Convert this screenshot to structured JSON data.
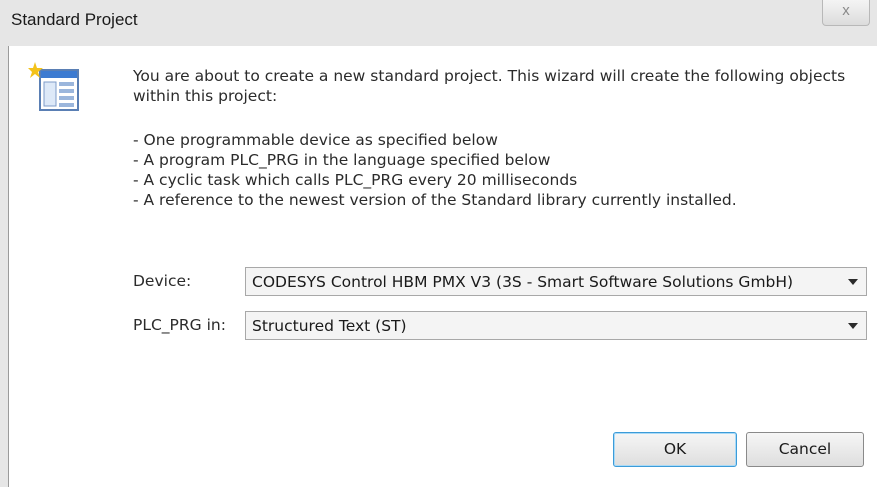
{
  "window": {
    "title": "Standard Project",
    "close_label": "x"
  },
  "icons": {
    "wizard": "new-project-wizard-icon",
    "close": "close-icon",
    "dropdown": "chevron-down-icon"
  },
  "intro": {
    "text": "You are about to create a new standard project. This wizard will create the following objects within this project:"
  },
  "bullets": [
    "- One programmable device as specified below",
    "- A program PLC_PRG in the language specified below",
    "- A cyclic task which calls PLC_PRG every 20 milliseconds",
    "- A reference to the newest version of the Standard library currently installed."
  ],
  "form": {
    "device_label": "Device:",
    "device_value": "CODESYS Control HBM PMX V3 (3S - Smart Software Solutions GmbH)",
    "language_label": "PLC_PRG in:",
    "language_value": "Structured Text (ST)"
  },
  "buttons": {
    "ok": "OK",
    "cancel": "Cancel"
  },
  "colors": {
    "title_bar": "#e6e6e6",
    "default_button_border": "#3c9bd8"
  }
}
